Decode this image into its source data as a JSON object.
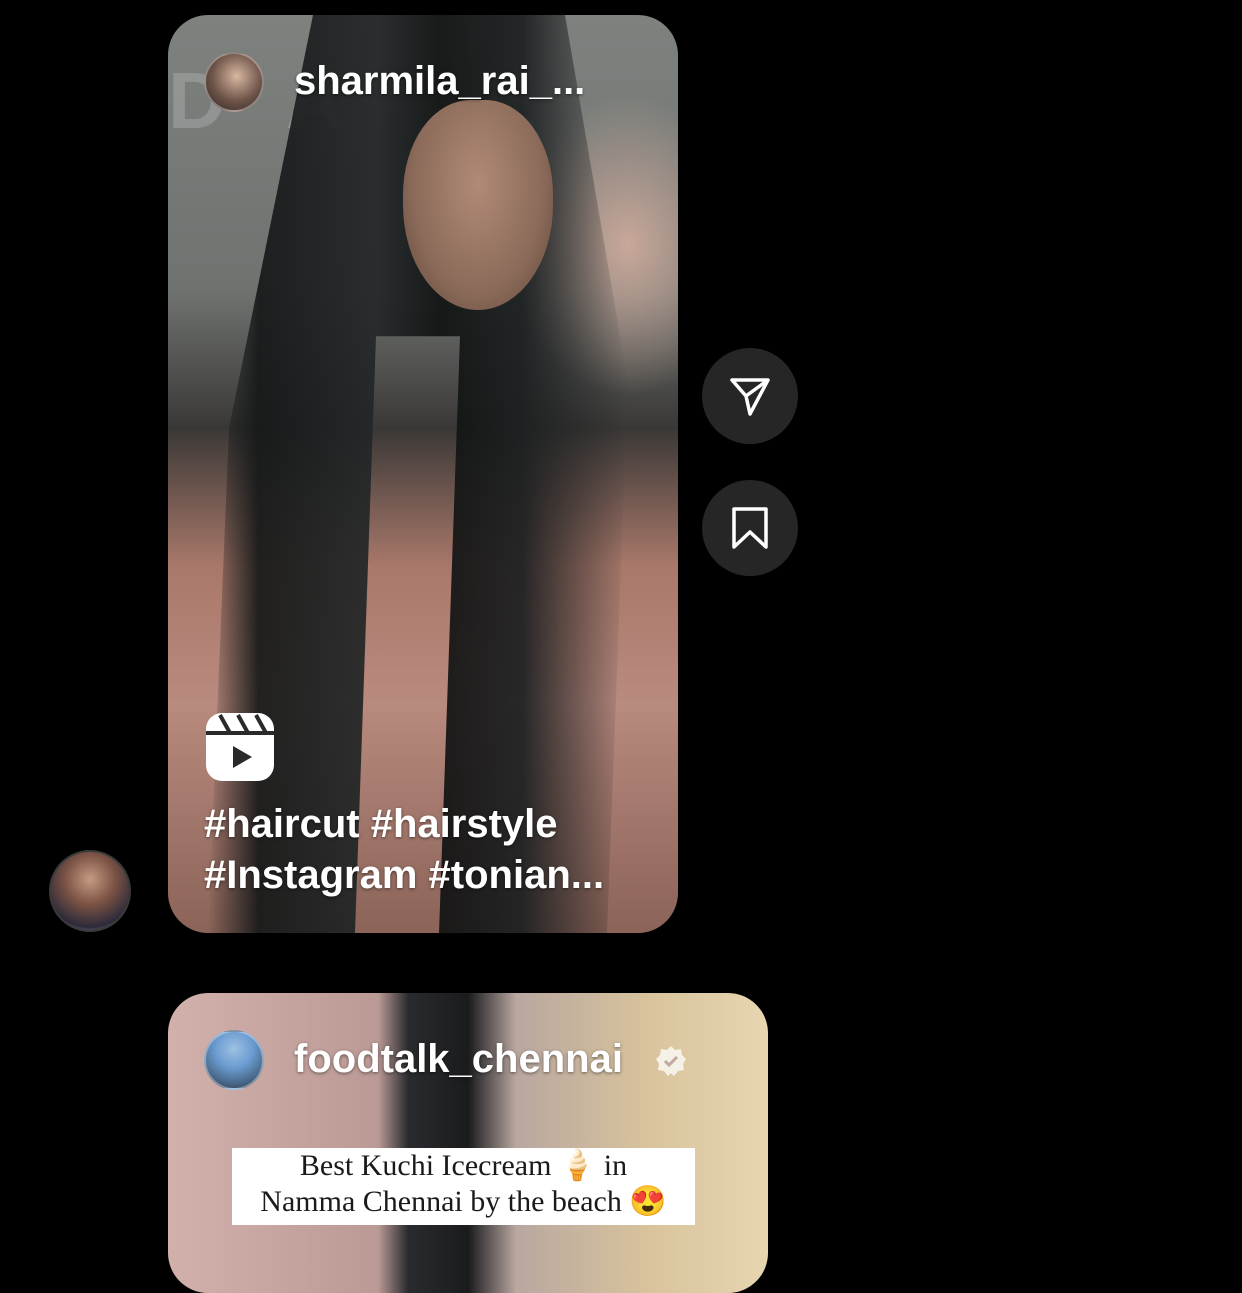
{
  "messages": [
    {
      "type": "reel",
      "username": "sharmila_rai_...",
      "watermark": "DA E",
      "caption_lines": [
        "#haircut #hairstyle",
        "#Instagram #tonian..."
      ]
    },
    {
      "type": "post",
      "username": "foodtalk_chennai",
      "verified": true,
      "overlay_lines": [
        "Best Kuchi Icecream 🍦 in",
        "Namma Chennai by the beach 😍"
      ]
    }
  ],
  "actions": {
    "share_icon": "paper-plane-icon",
    "save_icon": "bookmark-icon"
  },
  "colors": {
    "background": "#000000",
    "action_button": "#262626",
    "text": "#ffffff"
  }
}
